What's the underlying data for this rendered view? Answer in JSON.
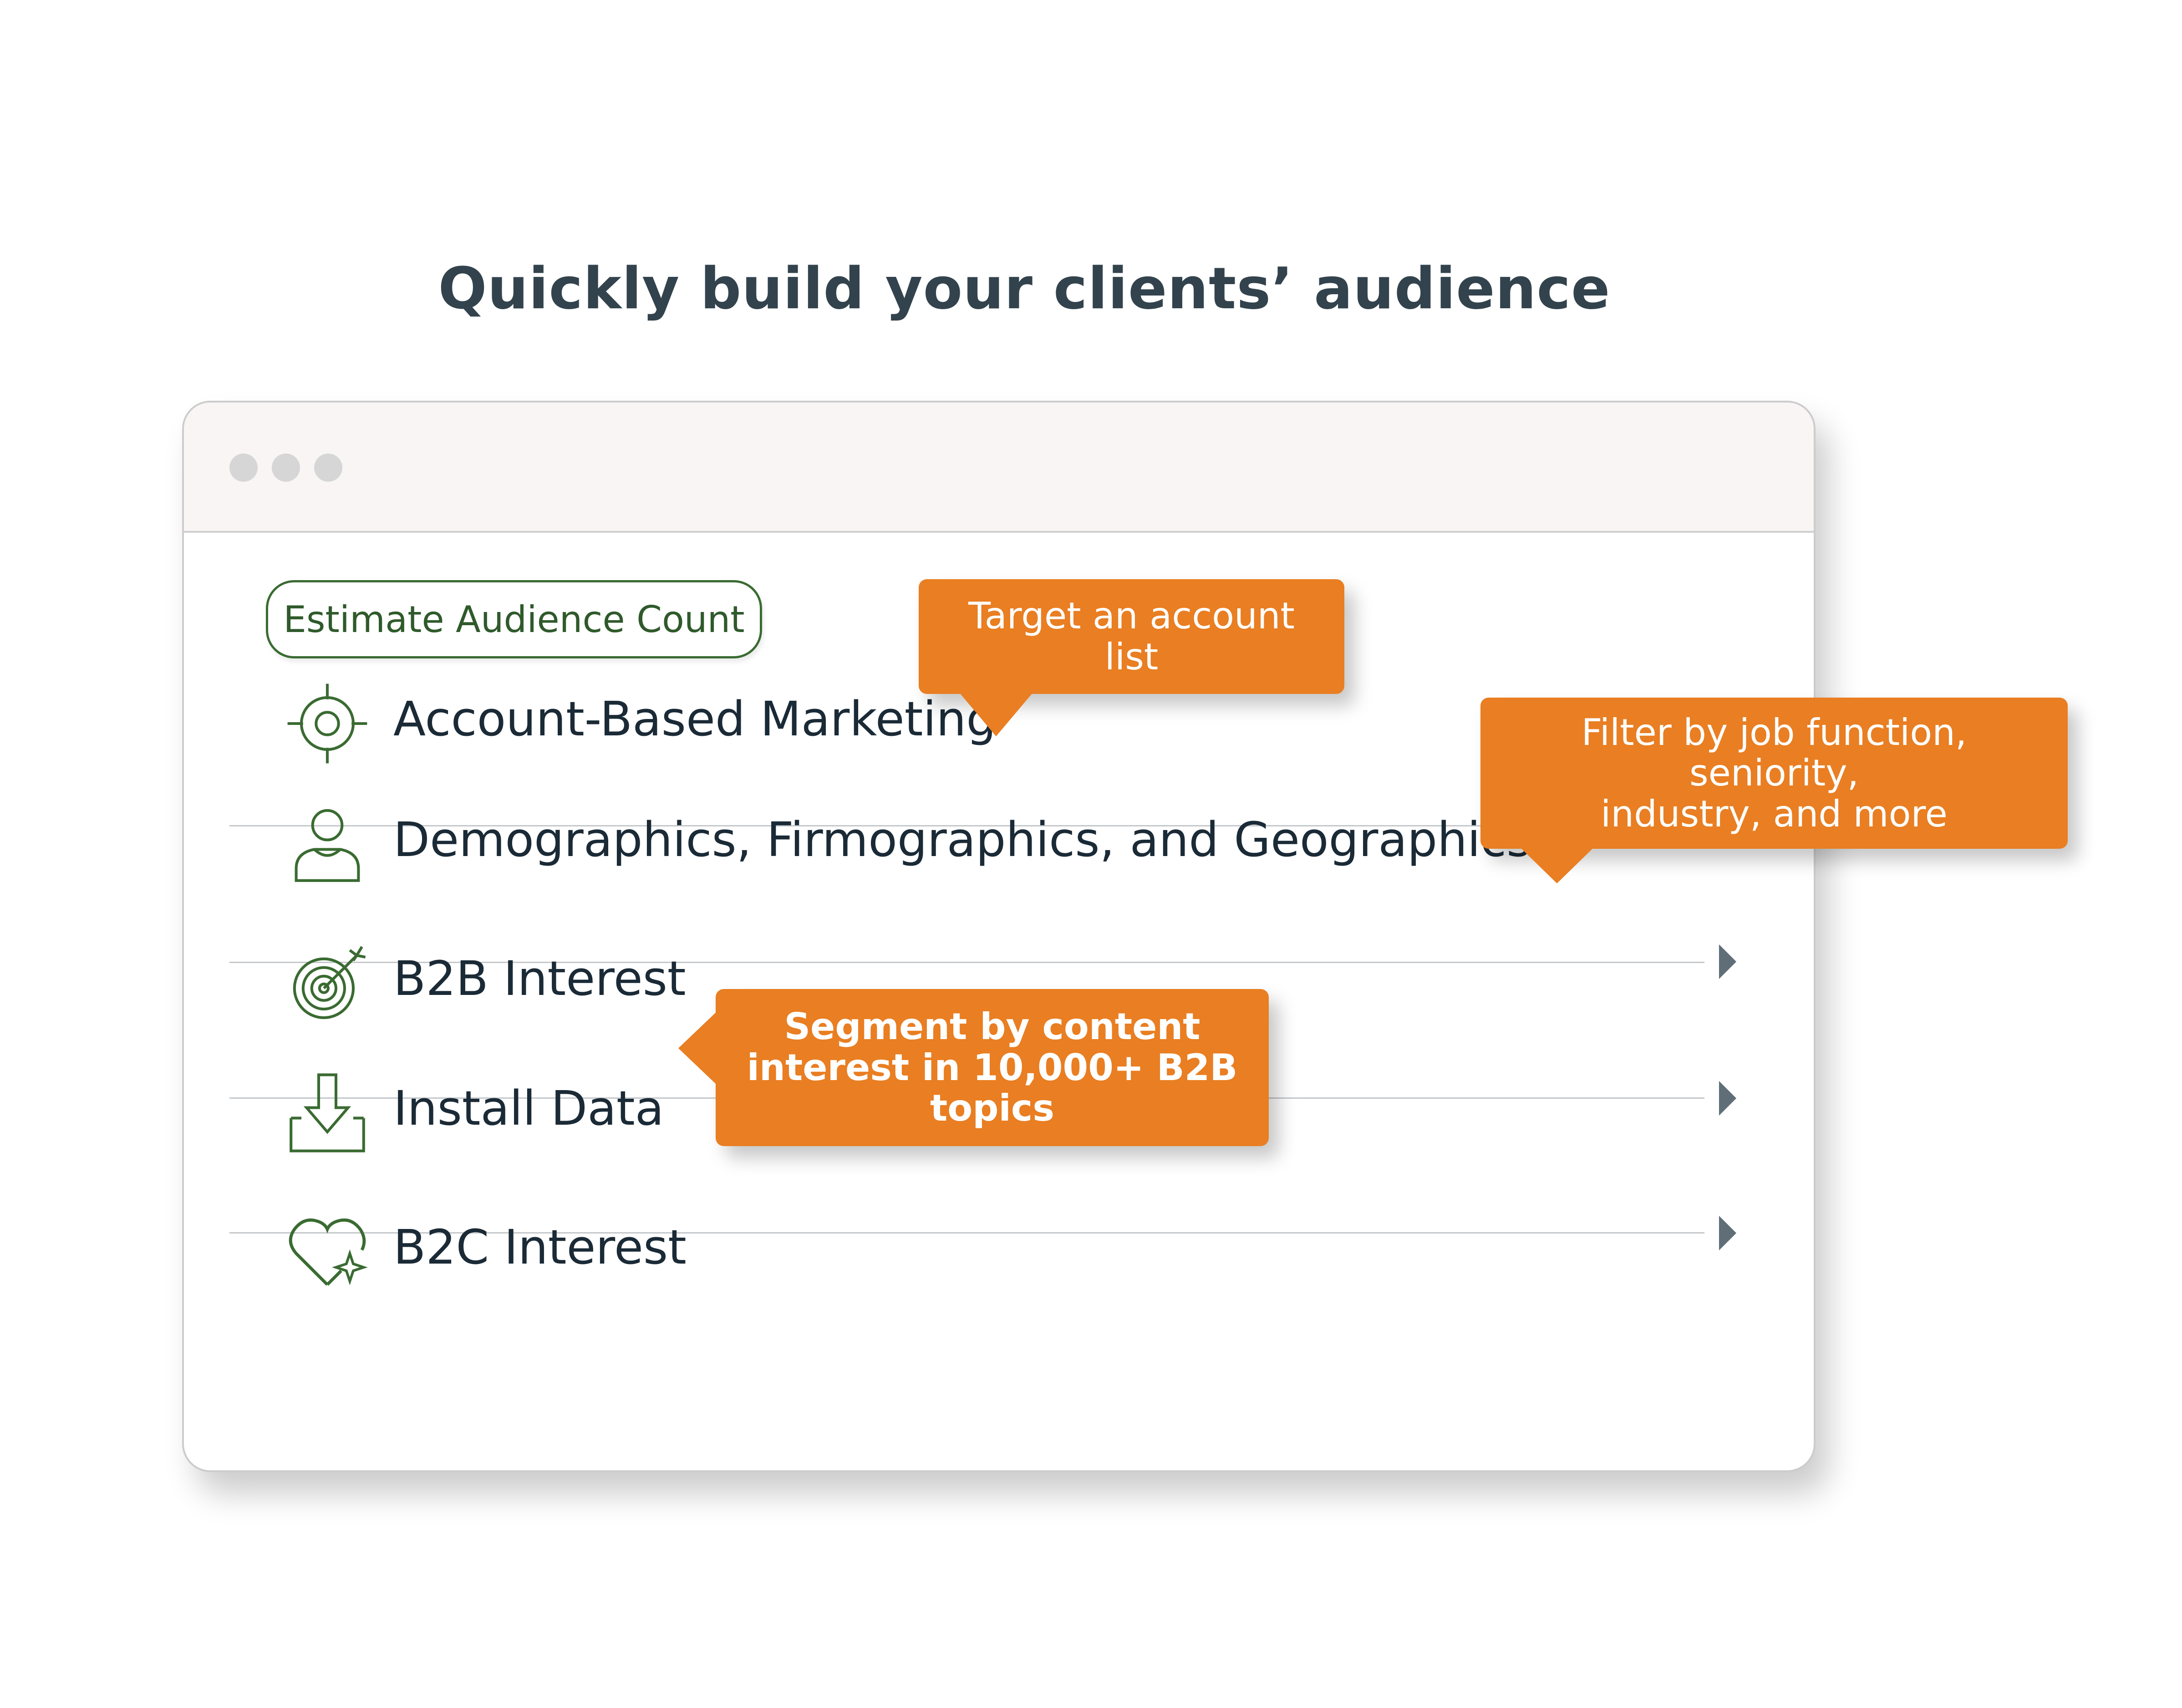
{
  "headline": "Quickly build your clients’ audience",
  "window": {
    "dots": [
      "window-dot",
      "window-dot",
      "window-dot"
    ]
  },
  "estimate_button": {
    "label": "Estimate Audience Count"
  },
  "rows": [
    {
      "label": "Account-Based Marketing",
      "icon": "crosshair-icon"
    },
    {
      "label": "Demographics, Firmographics, and Geographics",
      "icon": "person-icon"
    },
    {
      "label": "B2B Interest",
      "icon": "target-arrow-icon"
    },
    {
      "label": "Install Data",
      "icon": "download-tray-icon"
    },
    {
      "label": "B2C Interest",
      "icon": "heart-sparkle-icon"
    }
  ],
  "callouts": {
    "account_list": "Target an account list",
    "filter_line1": "Filter by job function, seniority,",
    "filter_line2": "industry, and more",
    "segment_line1": "Segment by content",
    "segment_line2": "interest in 10,000+ B2B topics"
  },
  "colors": {
    "accent_orange": "#e97e22",
    "icon_green": "#3a6b32",
    "text_dark": "#1a2a36",
    "headline": "#33434d"
  }
}
